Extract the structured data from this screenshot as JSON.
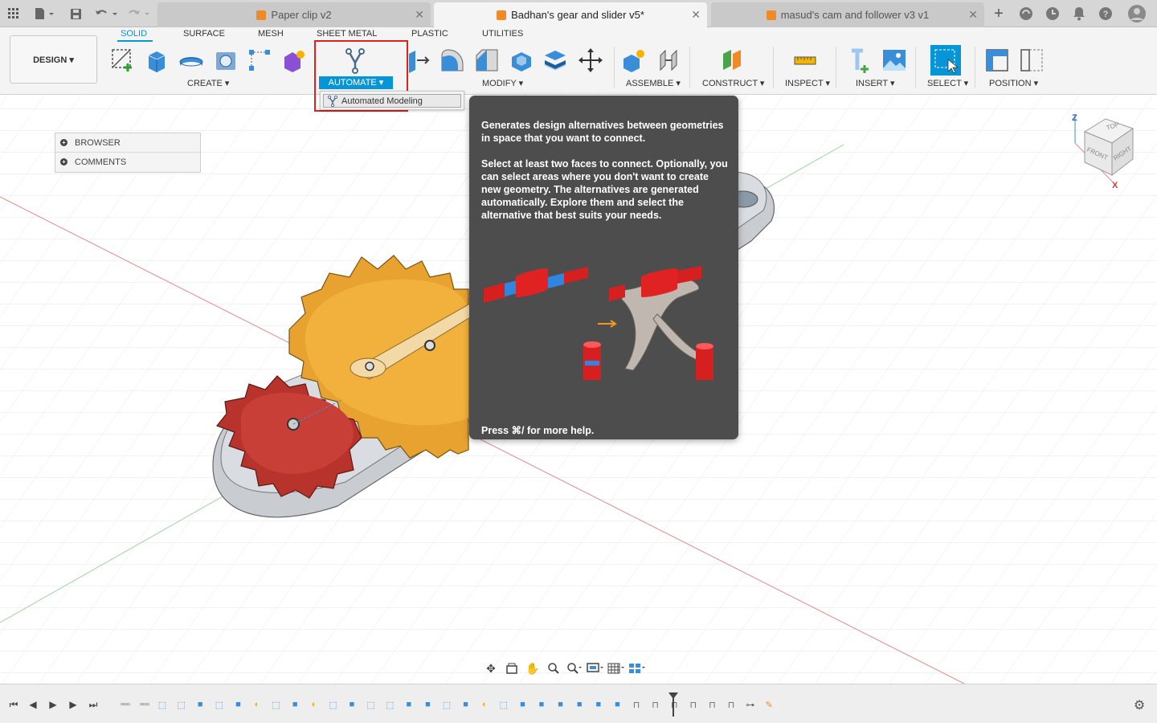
{
  "tabs": [
    {
      "label": "Paper clip v2",
      "active": false
    },
    {
      "label": "Badhan's gear and slider v5*",
      "active": true
    },
    {
      "label": "masud's cam and follower v3 v1",
      "active": false
    }
  ],
  "ribbon": {
    "design_label": "DESIGN ▾",
    "workspace_tabs": [
      "SOLID",
      "SURFACE",
      "MESH",
      "SHEET METAL",
      "PLASTIC",
      "UTILITIES"
    ],
    "groups": {
      "create": "CREATE ▾",
      "automate": "AUTOMATE ▾",
      "modify": "MODIFY ▾",
      "assemble": "ASSEMBLE ▾",
      "construct": "CONSTRUCT ▾",
      "inspect": "INSPECT ▾",
      "insert": "INSERT ▾",
      "select": "SELECT ▾",
      "position": "POSITION ▾"
    }
  },
  "dropdown": {
    "item": "Automated Modeling"
  },
  "browser": {
    "items": [
      "BROWSER",
      "COMMENTS"
    ]
  },
  "tooltip": {
    "para1": "Generates design alternatives between geometries in space that you want to connect.",
    "para2": "Select at least two faces to connect. Optionally, you can select areas where you don't want to create new geometry. The alternatives are generated automatically. Explore them and select the alternative that best suits your needs.",
    "help": "Press ⌘/ for more help."
  },
  "viewcube": {
    "top": "TOP",
    "front": "FRONT",
    "right": "RIGHT",
    "axis_z": "Z",
    "axis_x": "X"
  },
  "colors": {
    "accent": "#0696d7",
    "highlight": "#e0201b",
    "gear_large": "#e8a22f",
    "gear_small": "#b8332c",
    "tooltip_bg": "#4d4d4d"
  }
}
